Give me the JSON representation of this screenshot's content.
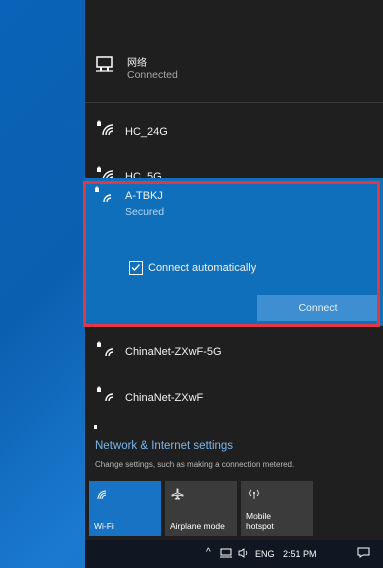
{
  "network": {
    "name": "网络",
    "status": "Connected"
  },
  "wifi_list": [
    {
      "ssid": "HC_24G"
    },
    {
      "ssid": "HC_5G"
    }
  ],
  "selected_network": {
    "ssid": "A-TBKJ",
    "status": "Secured",
    "auto_connect_label": "Connect automatically",
    "auto_connect_checked": true,
    "connect_button": "Connect"
  },
  "wifi_list_after": [
    {
      "ssid": "ChinaNet-ZXwF-5G"
    },
    {
      "ssid": "ChinaNet-ZXwF"
    }
  ],
  "settings": {
    "title": "Network & Internet settings",
    "description": "Change settings, such as making a connection metered."
  },
  "quick_actions": [
    {
      "label": "Wi-Fi",
      "active": true,
      "icon": "wifi-icon"
    },
    {
      "label": "Airplane mode",
      "active": false,
      "icon": "airplane-icon"
    },
    {
      "label": "Mobile hotspot",
      "active": false,
      "icon": "hotspot-icon"
    }
  ],
  "taskbar": {
    "language": "ENG",
    "time": "2:51 PM"
  },
  "colors": {
    "accent": "#0f6fba",
    "highlight_border": "#e23744",
    "flyout_bg": "#1f1f1f",
    "link": "#7ab8ef"
  }
}
